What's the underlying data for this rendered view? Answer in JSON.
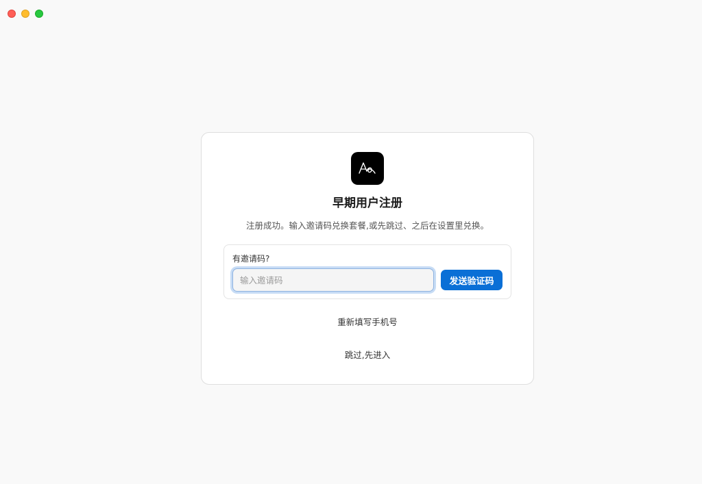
{
  "window": {
    "controls": [
      "close",
      "minimize",
      "zoom"
    ]
  },
  "card": {
    "logo_icon": "app-logo-icon",
    "title": "早期用户注册",
    "subtitle": "注册成功。输入邀请码兑换套餐,或先跳过、之后在设置里兑换。",
    "invite": {
      "label": "有邀请码?",
      "placeholder": "输入邀请码",
      "value": "",
      "button_label": "发送验证码"
    },
    "refill_phone_label": "重新填写手机号",
    "skip_label": "跳过,先进入"
  },
  "colors": {
    "accent": "#0a6fd6",
    "background": "#f9f9f9",
    "card": "#ffffff"
  }
}
